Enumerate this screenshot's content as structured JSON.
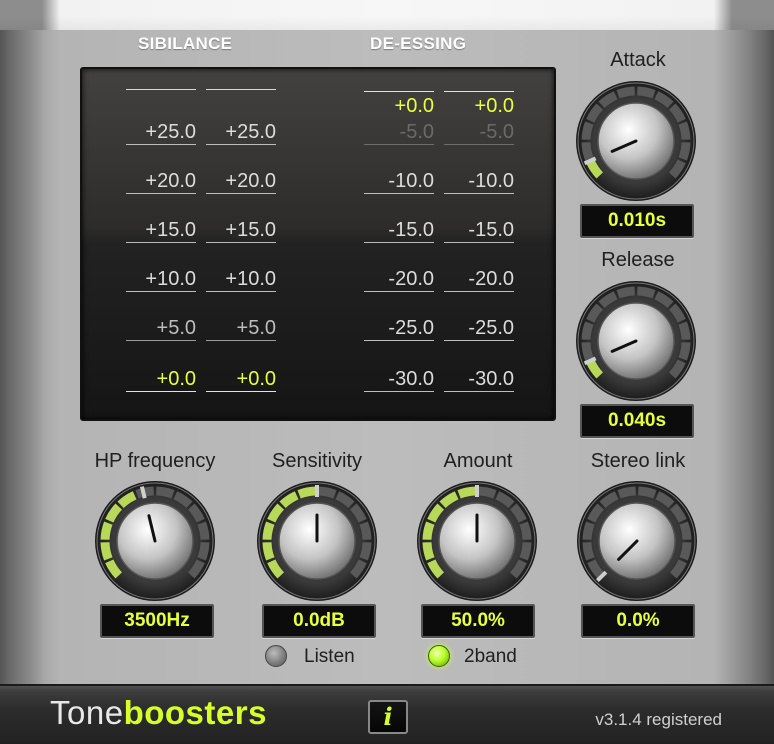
{
  "meter": {
    "sibilance_title": "SIBILANCE",
    "deessing_title": "DE-ESSING",
    "sibilance_scale": [
      "+25.0",
      "+20.0",
      "+15.0",
      "+10.0",
      "+5.0",
      "+0.0"
    ],
    "deessing_scale": [
      "+0.0",
      "-5.0",
      "-10.0",
      "-15.0",
      "-20.0",
      "-25.0",
      "-30.0"
    ]
  },
  "knobs": [
    {
      "id": "attack",
      "label": "Attack",
      "display": "0.010s",
      "value": 0.08
    },
    {
      "id": "release",
      "label": "Release",
      "display": "0.040s",
      "value": 0.08
    },
    {
      "id": "hp",
      "label": "HP frequency",
      "display": "3500Hz",
      "value": 0.45
    },
    {
      "id": "sensitivity",
      "label": "Sensitivity",
      "display": "0.0dB",
      "value": 0.5
    },
    {
      "id": "amount",
      "label": "Amount",
      "display": "50.0%",
      "value": 0.5
    },
    {
      "id": "stereo",
      "label": "Stereo link",
      "display": "0.0%",
      "value": 0.0
    }
  ],
  "toggles": {
    "listen": {
      "label": "Listen",
      "on": false
    },
    "twoband": {
      "label": "2band",
      "on": true
    }
  },
  "footer": {
    "logo_part1": "Tone",
    "logo_part2": "boosters",
    "info_label": "i",
    "version": "v3.1.4 registered"
  },
  "colors": {
    "accent": "#e8ff3a",
    "ring_on": "#b8d85a",
    "ring_off": "#cfcfcf"
  },
  "icons": {
    "info": "info-icon",
    "led": "led-indicator-icon"
  }
}
